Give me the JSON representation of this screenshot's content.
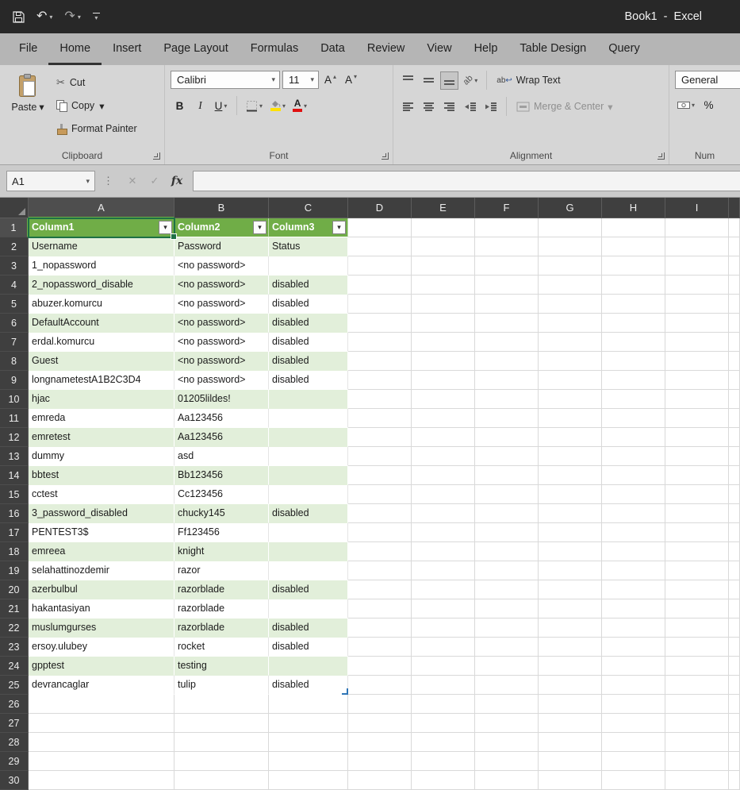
{
  "title_bar": {
    "title": "Book1  -  Excel"
  },
  "ribbon_tabs": [
    {
      "label": "File",
      "active": false
    },
    {
      "label": "Home",
      "active": true
    },
    {
      "label": "Insert",
      "active": false
    },
    {
      "label": "Page Layout",
      "active": false
    },
    {
      "label": "Formulas",
      "active": false
    },
    {
      "label": "Data",
      "active": false
    },
    {
      "label": "Review",
      "active": false
    },
    {
      "label": "View",
      "active": false
    },
    {
      "label": "Help",
      "active": false
    },
    {
      "label": "Table Design",
      "active": false
    },
    {
      "label": "Query",
      "active": false
    }
  ],
  "ribbon": {
    "clipboard": {
      "label": "Clipboard",
      "paste": "Paste",
      "cut": "Cut",
      "copy": "Copy",
      "format_painter": "Format Painter"
    },
    "font": {
      "label": "Font",
      "font_name": "Calibri",
      "font_size": "11",
      "bold": "B",
      "italic": "I",
      "underline": "U",
      "grow_font": "A",
      "shrink_font": "A"
    },
    "alignment": {
      "label": "Alignment",
      "orientation": "ab",
      "wrap_text": "Wrap Text",
      "merge_center": "Merge & Center"
    },
    "number": {
      "label": "Num",
      "format": "General",
      "percent": "%"
    }
  },
  "formula_bar": {
    "name_box": "A1",
    "fx_label": "fx",
    "formula": ""
  },
  "icons": {
    "dropdown": "▾",
    "undo": "↶",
    "redo": "↷",
    "cut": "✂",
    "cancel": "✕",
    "confirm": "✓",
    "splitter": "⋮",
    "wrap_ab": "ab",
    "wrap_arrow": "↩"
  },
  "sheet": {
    "columns": [
      "A",
      "B",
      "C",
      "D",
      "E",
      "F",
      "G",
      "H",
      "I"
    ],
    "row_count": 30,
    "selected_cell": "A1",
    "table": {
      "headers": [
        "Column1",
        "Column2",
        "Column3"
      ],
      "rows": [
        [
          "Username",
          "Password",
          "Status"
        ],
        [
          "1_nopassword",
          "<no password>",
          ""
        ],
        [
          "2_nopassword_disable",
          "<no password>",
          "disabled"
        ],
        [
          "abuzer.komurcu",
          "<no password>",
          "disabled"
        ],
        [
          "DefaultAccount",
          "<no password>",
          "disabled"
        ],
        [
          "erdal.komurcu",
          "<no password>",
          "disabled"
        ],
        [
          "Guest",
          "<no password>",
          "disabled"
        ],
        [
          "longnametestA1B2C3D4",
          "<no password>",
          "disabled"
        ],
        [
          "hjac",
          "01205lildes!",
          ""
        ],
        [
          "emreda",
          "Aa123456",
          ""
        ],
        [
          "emretest",
          "Aa123456",
          ""
        ],
        [
          "dummy",
          "asd",
          ""
        ],
        [
          "bbtest",
          "Bb123456",
          ""
        ],
        [
          "cctest",
          "Cc123456",
          ""
        ],
        [
          "3_password_disabled",
          "chucky145",
          "disabled"
        ],
        [
          "PENTEST3$",
          "Ff123456",
          ""
        ],
        [
          "emreea",
          "knight",
          ""
        ],
        [
          "selahattinozdemir",
          "razor",
          ""
        ],
        [
          "azerbulbul",
          "razorblade",
          "disabled"
        ],
        [
          "hakantasiyan",
          "razorblade",
          ""
        ],
        [
          "muslumgurses",
          "razorblade",
          "disabled"
        ],
        [
          "ersoy.ulubey",
          "rocket",
          "disabled"
        ],
        [
          "gpptest",
          "testing",
          ""
        ],
        [
          "devrancaglar",
          "tulip",
          "disabled"
        ]
      ]
    },
    "colors": {
      "table_header_fill": "#70AD47",
      "band_fill": "#E2EFDA",
      "selection_border": "#1E7145",
      "fill_color_swatch": "#FFE100",
      "font_color_swatch": "#E01010"
    }
  }
}
